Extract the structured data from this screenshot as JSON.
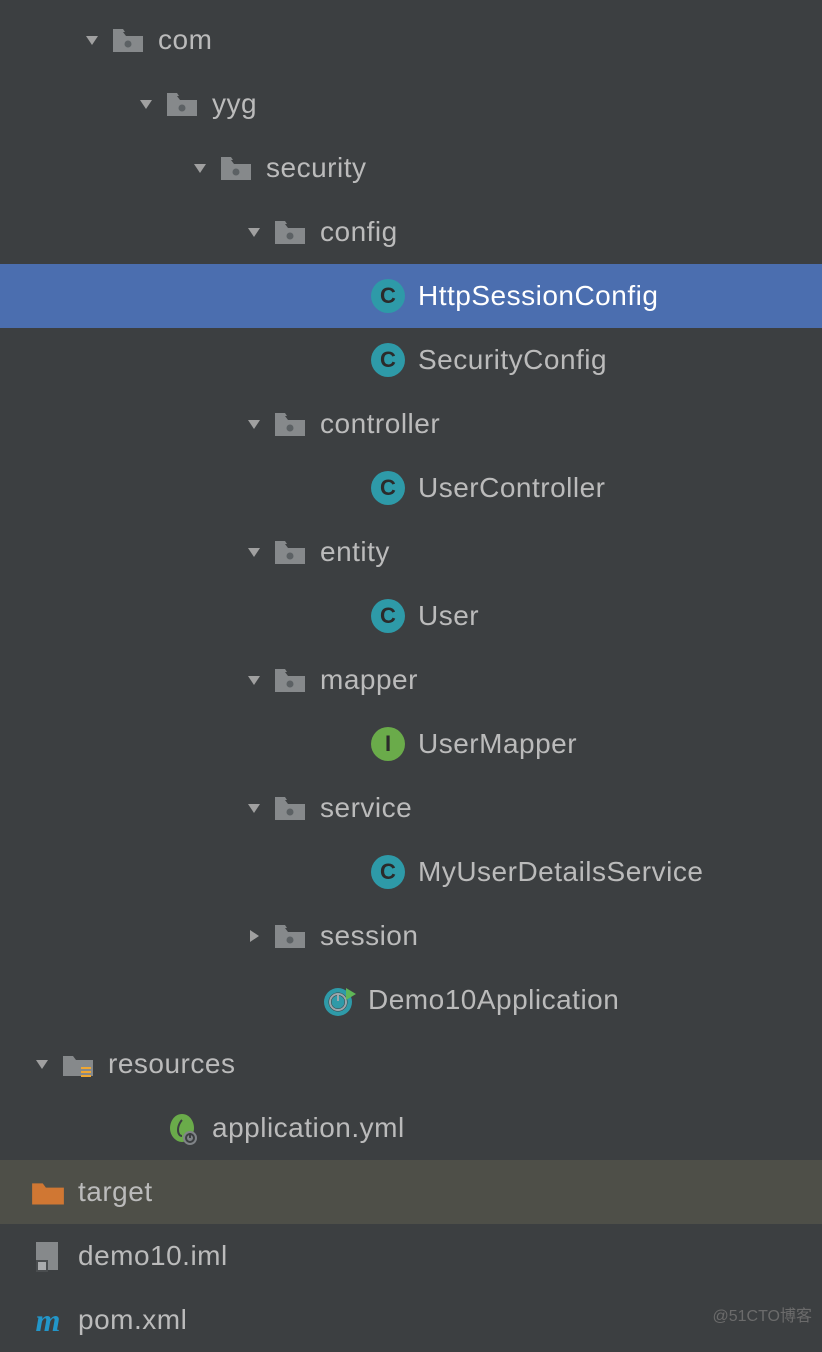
{
  "tree": [
    {
      "indent": 80,
      "arrow": "down",
      "icon": "folder",
      "label": "com",
      "selected": false,
      "interact": true
    },
    {
      "indent": 134,
      "arrow": "down",
      "icon": "folder",
      "label": "yyg",
      "selected": false,
      "interact": true
    },
    {
      "indent": 188,
      "arrow": "down",
      "icon": "folder",
      "label": "security",
      "selected": false,
      "interact": true
    },
    {
      "indent": 242,
      "arrow": "down",
      "icon": "folder",
      "label": "config",
      "selected": false,
      "interact": true
    },
    {
      "indent": 340,
      "arrow": "none",
      "icon": "class",
      "label": "HttpSessionConfig",
      "selected": true,
      "interact": true
    },
    {
      "indent": 340,
      "arrow": "none",
      "icon": "class",
      "label": "SecurityConfig",
      "selected": false,
      "interact": true
    },
    {
      "indent": 242,
      "arrow": "down",
      "icon": "folder",
      "label": "controller",
      "selected": false,
      "interact": true
    },
    {
      "indent": 340,
      "arrow": "none",
      "icon": "class",
      "label": "UserController",
      "selected": false,
      "interact": true
    },
    {
      "indent": 242,
      "arrow": "down",
      "icon": "folder",
      "label": "entity",
      "selected": false,
      "interact": true
    },
    {
      "indent": 340,
      "arrow": "none",
      "icon": "class",
      "label": "User",
      "selected": false,
      "interact": true
    },
    {
      "indent": 242,
      "arrow": "down",
      "icon": "folder",
      "label": "mapper",
      "selected": false,
      "interact": true
    },
    {
      "indent": 340,
      "arrow": "none",
      "icon": "interface",
      "label": "UserMapper",
      "selected": false,
      "interact": true
    },
    {
      "indent": 242,
      "arrow": "down",
      "icon": "folder",
      "label": "service",
      "selected": false,
      "interact": true
    },
    {
      "indent": 340,
      "arrow": "none",
      "icon": "class",
      "label": "MyUserDetailsService",
      "selected": false,
      "interact": true
    },
    {
      "indent": 242,
      "arrow": "right",
      "icon": "folder",
      "label": "session",
      "selected": false,
      "interact": true
    },
    {
      "indent": 290,
      "arrow": "none",
      "icon": "spring-run",
      "label": "Demo10Application",
      "selected": false,
      "interact": true
    },
    {
      "indent": 30,
      "arrow": "down",
      "icon": "folder-res",
      "label": "resources",
      "selected": false,
      "interact": true
    },
    {
      "indent": 134,
      "arrow": "none",
      "icon": "spring-yml",
      "label": "application.yml",
      "selected": false,
      "interact": true
    },
    {
      "indent": 0,
      "arrow": "none",
      "icon": "folder-exc",
      "label": "target",
      "selected": false,
      "interact": true,
      "dim": true
    },
    {
      "indent": 0,
      "arrow": "none",
      "icon": "iml",
      "label": "demo10.iml",
      "selected": false,
      "interact": true
    },
    {
      "indent": 0,
      "arrow": "none",
      "icon": "maven",
      "label": "pom.xml",
      "selected": false,
      "interact": true
    }
  ],
  "watermark": "@51CTO博客"
}
